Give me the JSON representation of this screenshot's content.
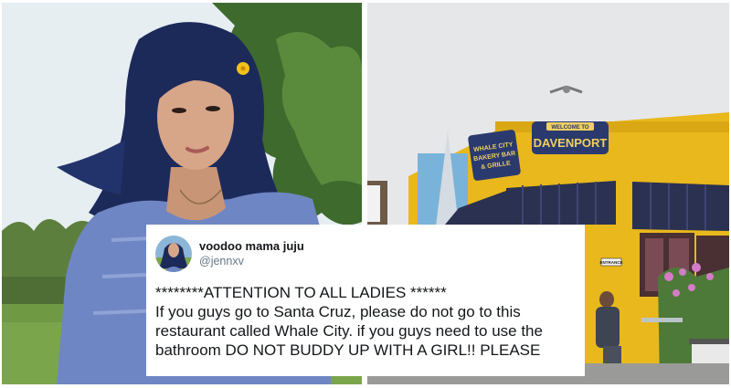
{
  "tweet": {
    "display_name": "voodoo mama juju",
    "handle": "@jennxv",
    "avatar_icon": "profile-avatar",
    "lines": [
      "********ATTENTION TO ALL LADIES ******",
      "If you guys go to Santa Cruz, please do not go to this",
      "restaurant called Whale City. if you guys need to use the",
      "bathroom DO NOT BUDDY UP WITH A GIRL!! PLEASE"
    ]
  },
  "storefront": {
    "signs": {
      "welcome": "WELCOME TO",
      "town": "DAVENPORT",
      "restaurant_1": "WHALE CITY",
      "restaurant_2": "BAKERY BAR",
      "restaurant_3": "& GRILLE",
      "entrance": "ENTRANCE"
    }
  },
  "colors": {
    "building_yellow": "#e8b81c",
    "awning_navy": "#2b3150",
    "hair_blue": "#1c2a5a",
    "dress_blue": "#6f86c4",
    "sky_gray": "#e6e7e9",
    "grass_green": "#6f9a43"
  }
}
